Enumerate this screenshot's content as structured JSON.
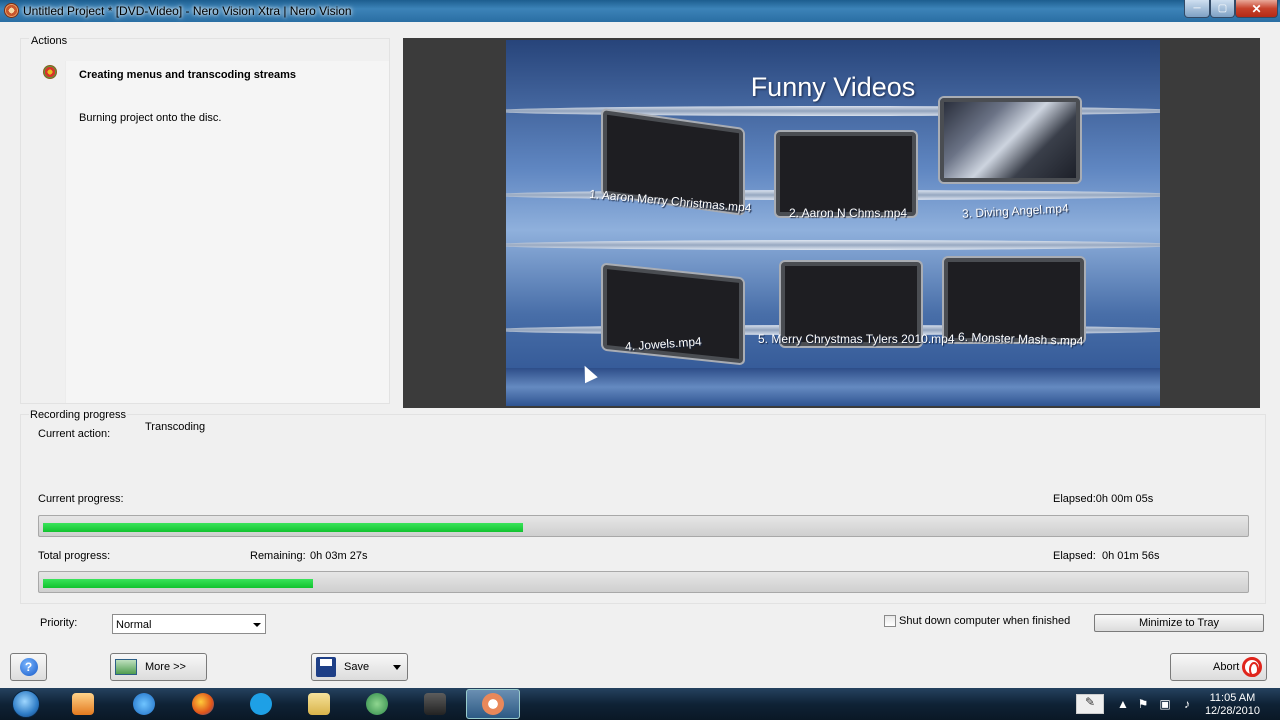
{
  "window": {
    "title": "Untitled Project * [DVD-Video] - Nero Vision Xtra | Nero Vision",
    "min_glyph": "─",
    "max_glyph": "▢",
    "close_glyph": "✕"
  },
  "actions": {
    "legend": "Actions",
    "current": "Creating menus and transcoding streams",
    "next": "Burning project onto the disc."
  },
  "preview": {
    "menu_title": "Funny Videos",
    "items": [
      "1. Aaron Merry Christmas.mp4",
      "2. Aaron N Chms.mp4",
      "3. Diving Angel.mp4",
      "4. Jowels.mp4",
      "5. Merry Chrystmas Tylers 2010.mp4",
      "6. Monster Mash s.mp4"
    ]
  },
  "recording": {
    "legend": "Recording progress",
    "current_action_label": "Current action:",
    "current_action_value": "Transcoding",
    "current_progress_label": "Current progress:",
    "current_elapsed": "Elapsed:0h 00m 05s",
    "current_progress_fraction": 0.4,
    "total_progress_label": "Total progress:",
    "remaining_label": "Remaining:",
    "remaining_value": "0h 03m 27s",
    "elapsed_label": "Elapsed:",
    "elapsed_value": "0h 01m 56s",
    "total_progress_fraction": 0.225
  },
  "controls": {
    "priority_label": "Priority:",
    "priority_value": "Normal",
    "shutdown_label": "Shut down computer when finished",
    "minimize_label": "Minimize to Tray",
    "help_glyph": "?",
    "more_label": "More >>",
    "save_label": "Save",
    "abort_label": "Abort"
  },
  "taskbar": {
    "time": "11:05 AM",
    "date": "12/28/2010",
    "icons": [
      "media-player-icon",
      "internet-explorer-icon",
      "firefox-icon",
      "skype-icon",
      "explorer-folder-icon",
      "network-icon",
      "camera-icon",
      "nero-icon"
    ]
  }
}
